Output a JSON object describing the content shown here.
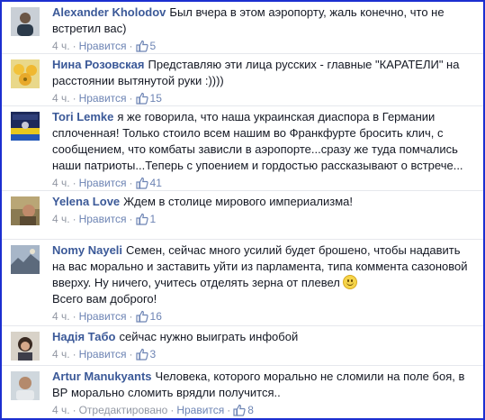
{
  "comments": [
    {
      "author": "Alexander Kholodov",
      "text": "Был вчера в этом аэропорту, жаль конечно, что не встретил вас)",
      "time": "4 ч.",
      "like_label": "Нравится",
      "likes": "5"
    },
    {
      "author": "Нина Розовская",
      "text": "Представляю эти лица русских - главные \"КАРАТЕЛИ\" на расстоянии вытянутой руки :))))",
      "time": "4 ч.",
      "like_label": "Нравится",
      "likes": "15"
    },
    {
      "author": "Tori Lemke",
      "text": "я же говорила, что наша украинская диаспора в Германии сплоченная! Только стоило всем нашим во Франкфурте бросить клич, с сообщением, что комбаты зависли в аэропорте...сразу же туда помчались наши патриоты...Теперь с упоением и гордостью рассказывают о встрече...",
      "time": "4 ч.",
      "like_label": "Нравится",
      "likes": "41"
    },
    {
      "author": "Yelena Love",
      "text": "Ждем в столице мирового империализма!",
      "time": "4 ч.",
      "like_label": "Нравится",
      "likes": "1"
    },
    {
      "author": "Nomy Nayeli",
      "text": "Семен, сейчас много усилий будет брошено, чтобы надавить на вас морально и заставить уйти из парламента, типа коммента сазоновой вверху. Ну ничего, учитесь отделять зерна от плевел",
      "text2": "Всего вам доброго!",
      "time": "4 ч.",
      "like_label": "Нравится",
      "likes": "16"
    },
    {
      "author": "Надія Табо",
      "text": "сейчас нужно выиграть инфобой",
      "time": "4 ч.",
      "like_label": "Нравится",
      "likes": "3"
    },
    {
      "author": "Artur Manukyants",
      "text": "Человека, которого морально не сломили на поле боя, в ВР морально сломить врядли получится..",
      "time": "4 ч.",
      "edited": "Отредактировано",
      "like_label": "Нравится",
      "likes": "8"
    }
  ],
  "colors": {
    "author": "#3b5998",
    "link": "#6d84b4",
    "meta": "#9197a3",
    "frame": "#1c2fd0"
  }
}
